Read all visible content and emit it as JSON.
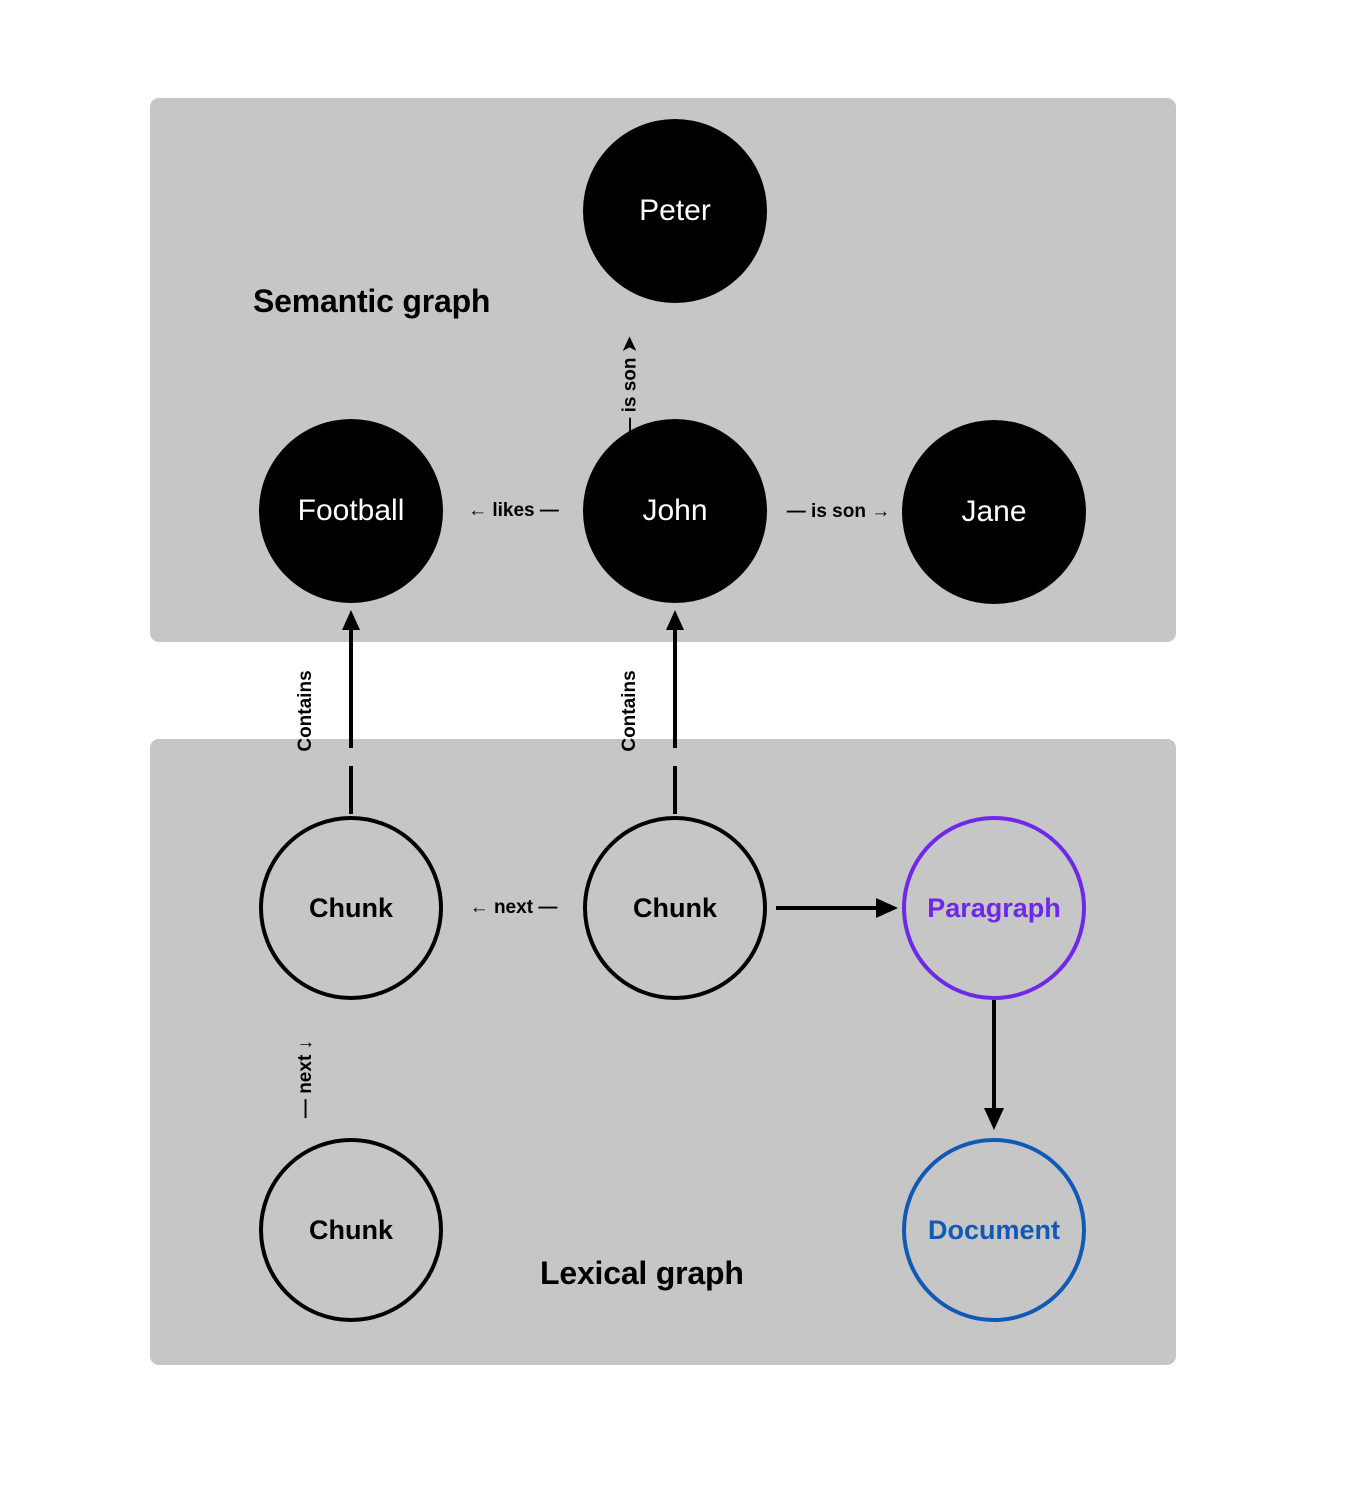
{
  "diagram": {
    "title_semantic": "Semantic graph",
    "title_lexical": "Lexical graph",
    "panel_background": "#c6c6c6",
    "colors": {
      "node_fill": "#000000",
      "node_text_light": "#ffffff",
      "paragraph": "#6f27e8",
      "document": "#1159b5",
      "edge": "#000000"
    }
  },
  "semantic_graph": {
    "nodes": [
      {
        "id": "peter",
        "label": "Peter",
        "style": "filled"
      },
      {
        "id": "football",
        "label": "Football",
        "style": "filled"
      },
      {
        "id": "john",
        "label": "John",
        "style": "filled"
      },
      {
        "id": "jane",
        "label": "Jane",
        "style": "filled"
      }
    ],
    "edges": [
      {
        "from": "john",
        "to": "peter",
        "label": "is son",
        "direction": "up",
        "prefix": "—",
        "suffix": "➤"
      },
      {
        "from": "john",
        "to": "football",
        "label": "likes",
        "direction": "left",
        "prefix": "←",
        "suffix": "—"
      },
      {
        "from": "john",
        "to": "jane",
        "label": "is son",
        "direction": "right",
        "prefix": "—",
        "suffix": "→"
      }
    ]
  },
  "lexical_graph": {
    "nodes": [
      {
        "id": "chunk-1",
        "label": "Chunk",
        "style": "outline"
      },
      {
        "id": "chunk-2",
        "label": "Chunk",
        "style": "outline"
      },
      {
        "id": "chunk-3",
        "label": "Chunk",
        "style": "outline"
      },
      {
        "id": "paragraph",
        "label": "Paragraph",
        "style": "outline",
        "color": "#6f27e8"
      },
      {
        "id": "document",
        "label": "Document",
        "style": "outline",
        "color": "#1159b5"
      }
    ],
    "edges": [
      {
        "from": "chunk-2",
        "to": "chunk-1",
        "label": "next",
        "direction": "left",
        "prefix": "←",
        "suffix": "—"
      },
      {
        "from": "chunk-1",
        "to": "chunk-3",
        "label": "next",
        "direction": "down",
        "prefix": "—",
        "suffix": "↓"
      },
      {
        "from": "chunk-2",
        "to": "paragraph",
        "label": "",
        "direction": "right"
      },
      {
        "from": "paragraph",
        "to": "document",
        "label": "",
        "direction": "down"
      }
    ]
  },
  "cross_graph_edges": [
    {
      "from": "chunk-1",
      "to": "football",
      "label": "Contains",
      "direction": "up"
    },
    {
      "from": "chunk-2",
      "to": "john",
      "label": "Contains",
      "direction": "up"
    }
  ]
}
